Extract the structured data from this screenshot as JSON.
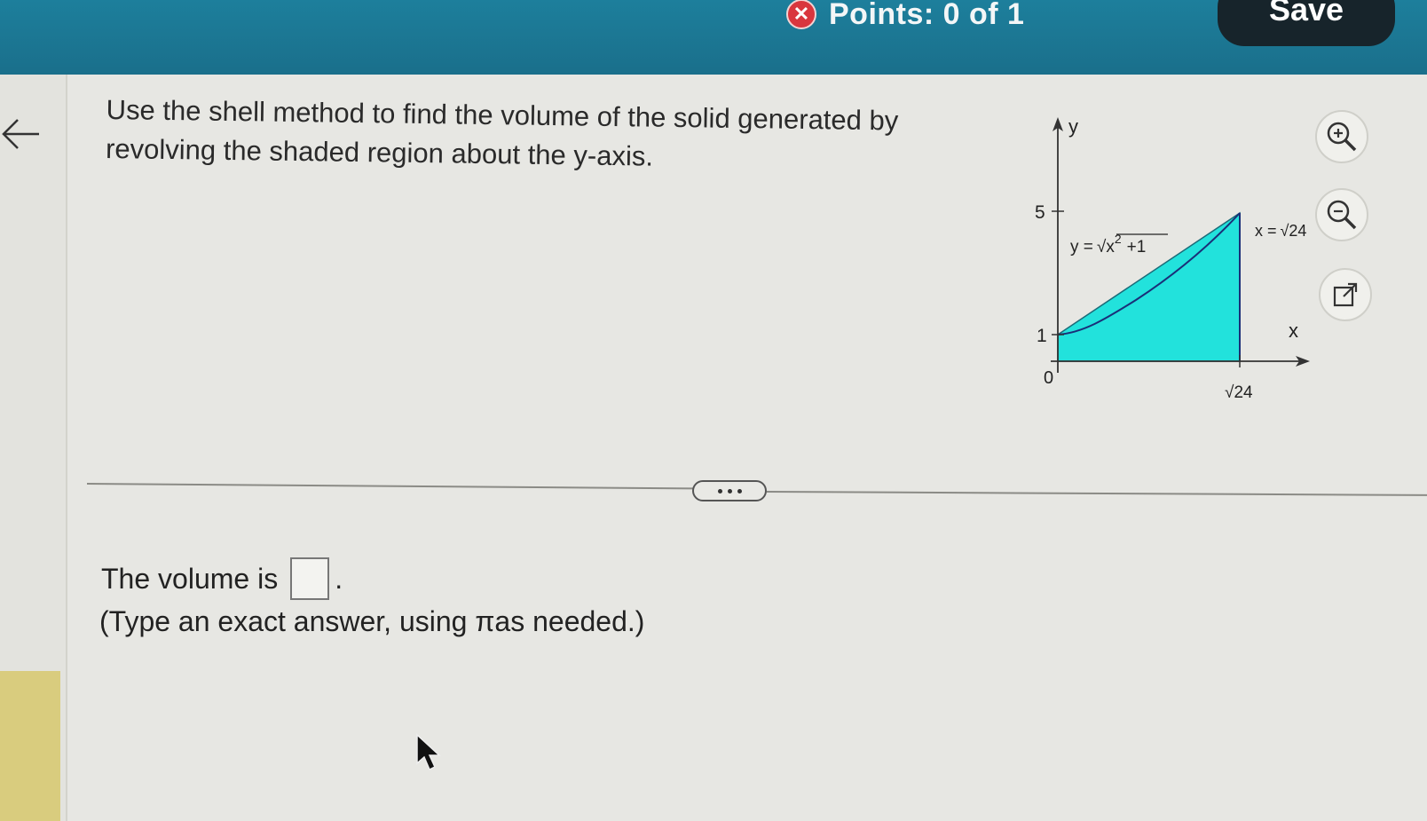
{
  "header": {
    "points_label": "Points: 0 of 1",
    "save_label": "Save",
    "status_icon": "x-circle-icon"
  },
  "question": {
    "text": "Use the shell method to find the volume of the solid generated by revolving the shaded region about the y-axis."
  },
  "graph": {
    "y_axis_label": "y",
    "x_axis_label": "x",
    "tick_y5": "5",
    "tick_y1": "1",
    "origin": "0",
    "x_tick_prefix": "√",
    "x_tick_value": "24",
    "curve_label_prefix": "y =",
    "curve_exponent": "2",
    "curve_radicand": "x",
    "curve_suffix": "+1",
    "line_label_prefix": "x =",
    "line_label_root": "√",
    "line_label_value": "24",
    "fill_color": "#22e2dc"
  },
  "answer": {
    "prefix": "The volume is",
    "suffix": ".",
    "hint": "(Type an exact answer, using πas needed.)"
  },
  "tools": {
    "zoom_in_icon": "zoom-in-icon",
    "zoom_out_icon": "zoom-out-icon",
    "popout_icon": "external-link-icon"
  }
}
